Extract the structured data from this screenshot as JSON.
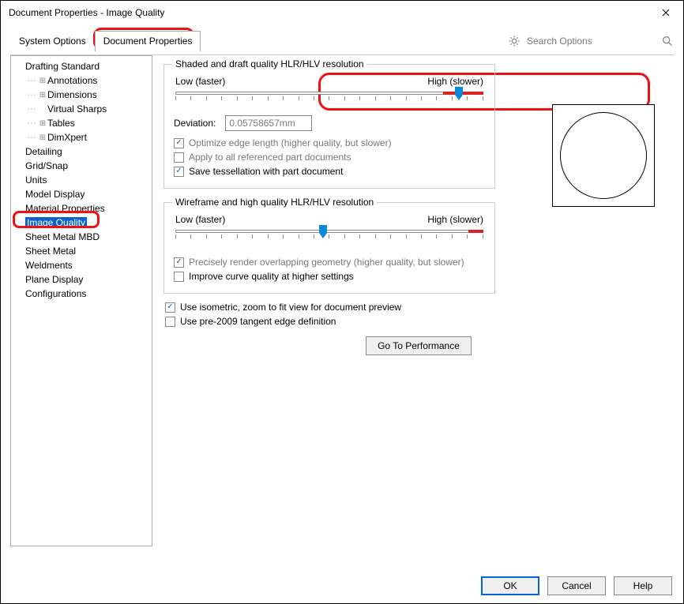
{
  "title": "Document Properties - Image Quality",
  "tabs": {
    "system": "System Options",
    "doc": "Document Properties"
  },
  "search": {
    "placeholder": "Search Options"
  },
  "tree": [
    {
      "label": "Drafting Standard",
      "expandable": false,
      "child": false
    },
    {
      "label": "Annotations",
      "expandable": true,
      "child": true
    },
    {
      "label": "Dimensions",
      "expandable": true,
      "child": true
    },
    {
      "label": "Virtual Sharps",
      "expandable": false,
      "child": true
    },
    {
      "label": "Tables",
      "expandable": true,
      "child": true
    },
    {
      "label": "DimXpert",
      "expandable": true,
      "child": true
    },
    {
      "label": "Detailing",
      "expandable": false,
      "child": false
    },
    {
      "label": "Grid/Snap",
      "expandable": false,
      "child": false
    },
    {
      "label": "Units",
      "expandable": false,
      "child": false
    },
    {
      "label": "Model Display",
      "expandable": false,
      "child": false
    },
    {
      "label": "Material Properties",
      "expandable": false,
      "child": false
    },
    {
      "label": "Image Quality",
      "expandable": false,
      "child": false,
      "selected": true
    },
    {
      "label": "Sheet Metal MBD",
      "expandable": false,
      "child": false
    },
    {
      "label": "Sheet Metal",
      "expandable": false,
      "child": false
    },
    {
      "label": "Weldments",
      "expandable": false,
      "child": false
    },
    {
      "label": "Plane Display",
      "expandable": false,
      "child": false
    },
    {
      "label": "Configurations",
      "expandable": false,
      "child": false
    }
  ],
  "section1": {
    "legend": "Shaded and draft quality HLR/HLV resolution",
    "low": "Low (faster)",
    "high": "High (slower)",
    "dev_label": "Deviation:",
    "dev_value": "0.05758657mm",
    "opt1": "Optimize edge length (higher quality, but slower)",
    "opt2": "Apply to all referenced part documents",
    "opt3": "Save tessellation with part document"
  },
  "section2": {
    "legend": "Wireframe and high quality HLR/HLV resolution",
    "low": "Low (faster)",
    "high": "High (slower)",
    "opt1": "Precisely render overlapping geometry (higher quality, but slower)",
    "opt2": "Improve curve quality at higher settings"
  },
  "extra": {
    "iso": "Use isometric, zoom to fit view for document preview",
    "pre2009": "Use pre-2009 tangent edge definition",
    "goto": "Go To Performance"
  },
  "buttons": {
    "ok": "OK",
    "cancel": "Cancel",
    "help": "Help"
  }
}
